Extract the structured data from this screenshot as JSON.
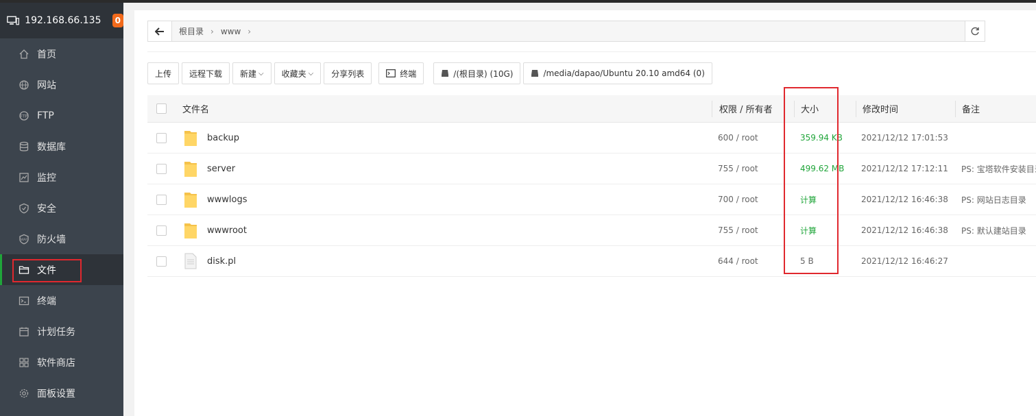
{
  "server": {
    "host": "192.168.66.135",
    "badge": "0"
  },
  "sidebar": {
    "items": [
      {
        "label": "首页",
        "icon": "home-icon"
      },
      {
        "label": "网站",
        "icon": "globe-icon"
      },
      {
        "label": "FTP",
        "icon": "ftp-icon"
      },
      {
        "label": "数据库",
        "icon": "database-icon"
      },
      {
        "label": "监控",
        "icon": "monitor-chart-icon"
      },
      {
        "label": "安全",
        "icon": "shield-icon"
      },
      {
        "label": "防火墙",
        "icon": "firewall-icon"
      },
      {
        "label": "文件",
        "icon": "folder-icon",
        "active": true
      },
      {
        "label": "终端",
        "icon": "terminal-icon"
      },
      {
        "label": "计划任务",
        "icon": "calendar-icon"
      },
      {
        "label": "软件商店",
        "icon": "apps-icon"
      },
      {
        "label": "面板设置",
        "icon": "gear-icon"
      }
    ]
  },
  "breadcrumb": {
    "root": "根目录",
    "current": "www"
  },
  "toolbar": {
    "upload": "上传",
    "remote_download": "远程下载",
    "new": "新建",
    "favorites": "收藏夹",
    "share_list": "分享列表",
    "terminal": "终端",
    "disk1": "/(根目录) (10G)",
    "disk2": "/media/dapao/Ubuntu 20.10 amd64 (0)"
  },
  "table": {
    "headers": {
      "name": "文件名",
      "perm": "权限 / 所有者",
      "size": "大小",
      "mtime": "修改时间",
      "note": "备注"
    },
    "rows": [
      {
        "type": "folder",
        "name": "backup",
        "perm": "600 / root",
        "size": "359.94 KB",
        "mtime": "2021/12/12 17:01:53",
        "note": ""
      },
      {
        "type": "folder",
        "name": "server",
        "perm": "755 / root",
        "size": "499.62 MB",
        "mtime": "2021/12/12 17:12:11",
        "note": "PS: 宝塔软件安装目录"
      },
      {
        "type": "folder",
        "name": "wwwlogs",
        "perm": "700 / root",
        "size": "计算",
        "mtime": "2021/12/12 16:46:38",
        "note": "PS: 网站日志目录"
      },
      {
        "type": "folder",
        "name": "wwwroot",
        "perm": "755 / root",
        "size": "计算",
        "mtime": "2021/12/12 16:46:38",
        "note": "PS: 默认建站目录"
      },
      {
        "type": "file",
        "name": "disk.pl",
        "perm": "644 / root",
        "size": "5 B",
        "mtime": "2021/12/12 16:46:27",
        "note": ""
      }
    ]
  },
  "colors": {
    "accent": "#20a53a",
    "highlight": "#e0282e",
    "sidebar": "#3c444d"
  }
}
